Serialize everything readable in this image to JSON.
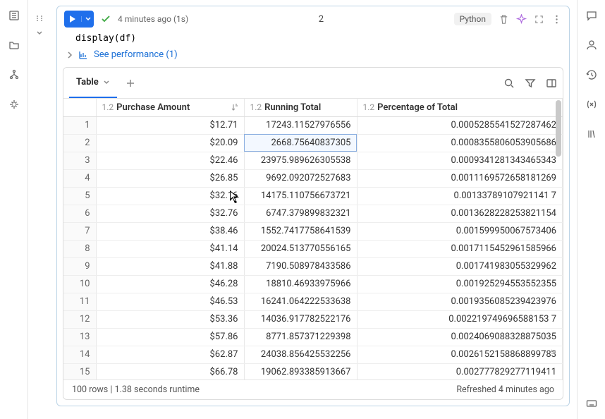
{
  "cell": {
    "status_text": "4 minutes ago (1s)",
    "exec_count": "2",
    "language": "Python",
    "code": "display(df)",
    "perf_label": "See performance (1)"
  },
  "output": {
    "tab_label": "Table",
    "columns": {
      "purchase": {
        "type": "1.2",
        "label": "Purchase Amount"
      },
      "running": {
        "type": "1.2",
        "label": "Running Total"
      },
      "pct": {
        "type": "1.2",
        "label": "Percentage of Total"
      }
    },
    "rows": [
      {
        "n": "1",
        "amount": "$12.71",
        "running": "17243.11527976556",
        "pct": "0.0005285541527287462"
      },
      {
        "n": "2",
        "amount": "$20.09",
        "running": "2668.75640837305",
        "pct": "0.0008355806053905686"
      },
      {
        "n": "3",
        "amount": "$22.46",
        "running": "23975.989626305538",
        "pct": "0.0009341281343465343"
      },
      {
        "n": "4",
        "amount": "$26.85",
        "running": "9692.092072527683",
        "pct": "0.0011169572658181269"
      },
      {
        "n": "5",
        "amount": "$32.16",
        "running": "14175.110756673721",
        "pct": "0.00133789107921141 7"
      },
      {
        "n": "6",
        "amount": "$32.76",
        "running": "6747.379899832321",
        "pct": "0.0013628228253821154"
      },
      {
        "n": "7",
        "amount": "$38.46",
        "running": "1552.7417758641539",
        "pct": "0.001599950067573406"
      },
      {
        "n": "8",
        "amount": "$41.14",
        "running": "20024.513770556165",
        "pct": "0.0017115452961585966"
      },
      {
        "n": "9",
        "amount": "$41.88",
        "running": "7190.508978433586",
        "pct": "0.001741983055329962"
      },
      {
        "n": "10",
        "amount": "$46.28",
        "running": "18810.46933975966",
        "pct": "0.001925294553552355"
      },
      {
        "n": "11",
        "amount": "$46.53",
        "running": "16241.064222533638",
        "pct": "0.0019356085239423976"
      },
      {
        "n": "12",
        "amount": "$53.36",
        "running": "14036.917782522176",
        "pct": "0.002219749696588153 7"
      },
      {
        "n": "13",
        "amount": "$57.86",
        "running": "8771.857371229398",
        "pct": "0.0024069088328875035"
      },
      {
        "n": "14",
        "amount": "$62.87",
        "running": "24038.856425532256",
        "pct": "0.0026152158868899783"
      },
      {
        "n": "15",
        "amount": "$66.78",
        "running": "19062.893385913667",
        "pct": "0.002777829277119411"
      }
    ],
    "selected_row_index": 1,
    "footer_left": "100 rows  |  1.38 seconds runtime",
    "footer_right": "Refreshed 4 minutes ago"
  },
  "chart_data": {
    "type": "table",
    "columns": [
      "Purchase Amount",
      "Running Total",
      "Percentage of Total"
    ],
    "rows": [
      [
        12.71,
        17243.11527976556,
        0.0005285541527287462
      ],
      [
        20.09,
        2668.75640837305,
        0.0008355806053905686
      ],
      [
        22.46,
        23975.989626305538,
        0.0009341281343465343
      ],
      [
        26.85,
        9692.092072527683,
        0.0011169572658181269
      ],
      [
        32.16,
        14175.110756673721,
        0.001337891079211417
      ],
      [
        32.76,
        6747.379899832321,
        0.0013628228253821154
      ],
      [
        38.46,
        1552.7417758641539,
        0.001599950067573406
      ],
      [
        41.14,
        20024.513770556165,
        0.0017115452961585966
      ],
      [
        41.88,
        7190.508978433586,
        0.001741983055329962
      ],
      [
        46.28,
        18810.46933975966,
        0.001925294553552355
      ],
      [
        46.53,
        16241.064222533638,
        0.0019356085239423976
      ],
      [
        53.36,
        14036.917782522176,
        0.0022197496965881535
      ],
      [
        57.86,
        8771.857371229398,
        0.0024069088328875035
      ],
      [
        62.87,
        24038.856425532256,
        0.0026152158868899783
      ],
      [
        66.78,
        19062.893385913667,
        0.002777829277119411
      ]
    ],
    "total_rows": 100,
    "runtime_seconds": 1.38
  }
}
